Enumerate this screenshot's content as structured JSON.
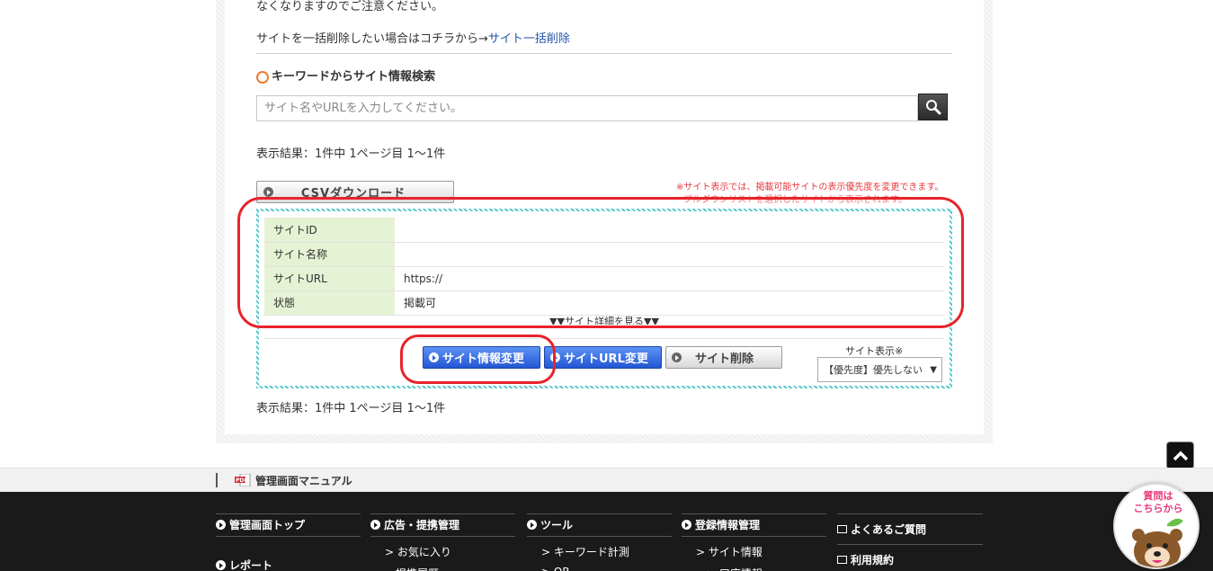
{
  "notice": {
    "text": "なくなりますのでご注意ください。"
  },
  "bulk_delete": {
    "prefix": "サイトを一括削除したい場合はコチラから→",
    "link": "サイト一括削除"
  },
  "keyword_search": {
    "title": "キーワードからサイト情報検索",
    "placeholder": "サイト名やURLを入力してください。"
  },
  "results": {
    "summary_top": "表示結果：1件中 1ページ目 1〜1件",
    "summary_bottom": "表示結果：1件中 1ページ目 1〜1件"
  },
  "csv_button": "CSVダウンロード",
  "notes": {
    "line1": "※サイト表示では、掲載可能サイトの表示優先度を変更できます。",
    "line2": "プルダウンリストを選択したサイトから表示されます。"
  },
  "site_table": {
    "rows": [
      {
        "label": "サイトID",
        "value": ""
      },
      {
        "label": "サイト名称",
        "value": ""
      },
      {
        "label": "サイトURL",
        "value": "https://"
      },
      {
        "label": "状態",
        "value": "掲載可"
      }
    ],
    "detail_link": "▼▼サイト詳細を見る▼▼"
  },
  "actions": {
    "edit_info": "サイト情報変更",
    "edit_url": "サイトURL変更",
    "delete": "サイト削除"
  },
  "site_display": {
    "label": "サイト表示※",
    "selected": "【優先度】優先しない"
  },
  "manual": {
    "label": "管理画面マニュアル"
  },
  "footer": {
    "col1": {
      "head": "管理画面トップ",
      "head2": "レポート"
    },
    "col2": {
      "head": "広告・提携管理",
      "item1": "> お気に入り",
      "item2": "提携履歴"
    },
    "col3": {
      "head": "ツール",
      "item1": "> キーワード計測",
      "item2": "> QR"
    },
    "col4": {
      "head": "登録情報管理",
      "item1": "> サイト情報",
      "item2": "> 口座情報"
    },
    "col5": {
      "item1": "よくあるご質問",
      "item2": "利用規約"
    }
  },
  "help_widget": {
    "line1": "質問は",
    "line2": "こちらから"
  },
  "colors": {
    "accent_blue": "#2356d3",
    "highlight_red": "#e8232a",
    "table_header_green": "#e6f2d4",
    "border_teal": "#56c9cc",
    "note_red": "#e8383d"
  },
  "icons": [
    "circle-icon",
    "search-icon",
    "arrow-up-icon",
    "pdf-icon",
    "window-icon"
  ]
}
